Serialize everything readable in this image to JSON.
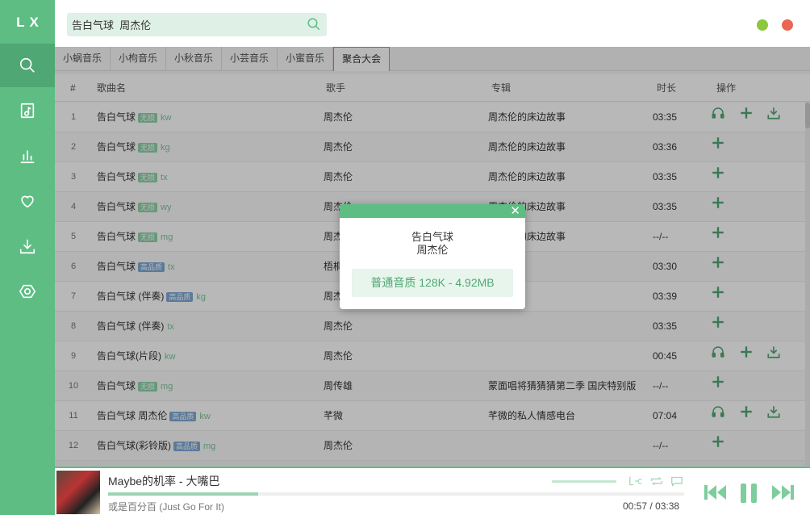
{
  "app": {
    "logo": "LX"
  },
  "search": {
    "value": "告白气球  周杰伦"
  },
  "sources": {
    "tabs": [
      {
        "label": "小蜗音乐"
      },
      {
        "label": "小枸音乐"
      },
      {
        "label": "小秋音乐"
      },
      {
        "label": "小芸音乐"
      },
      {
        "label": "小蜜音乐"
      },
      {
        "label": "聚合大会"
      }
    ],
    "active_index": 5
  },
  "table": {
    "headers": {
      "index": "#",
      "name": "歌曲名",
      "singer": "歌手",
      "album": "专辑",
      "duration": "时长",
      "ops": "操作"
    },
    "rows": [
      {
        "idx": "1",
        "name": "告白气球",
        "badge": "无损",
        "badge_type": "lossless",
        "src": "kw",
        "singer": "周杰伦",
        "album": "周杰伦的床边故事",
        "duration": "03:35",
        "ops": [
          "listen",
          "add",
          "download"
        ]
      },
      {
        "idx": "2",
        "name": "告白气球",
        "badge": "无损",
        "badge_type": "lossless",
        "src": "kg",
        "singer": "周杰伦",
        "album": "周杰伦的床边故事",
        "duration": "03:36",
        "ops": [
          "add"
        ]
      },
      {
        "idx": "3",
        "name": "告白气球",
        "badge": "无损",
        "badge_type": "lossless",
        "src": "tx",
        "singer": "周杰伦",
        "album": "周杰伦的床边故事",
        "duration": "03:35",
        "ops": [
          "add"
        ]
      },
      {
        "idx": "4",
        "name": "告白气球",
        "badge": "无损",
        "badge_type": "lossless",
        "src": "wy",
        "singer": "周杰伦",
        "album": "周杰伦的床边故事",
        "duration": "03:35",
        "ops": [
          "add"
        ]
      },
      {
        "idx": "5",
        "name": "告白气球",
        "badge": "无损",
        "badge_type": "lossless",
        "src": "mg",
        "singer": "周杰伦",
        "album": "周杰伦的床边故事",
        "duration": "--/--",
        "ops": [
          "add"
        ]
      },
      {
        "idx": "6",
        "name": "告白气球",
        "badge": "高品质",
        "badge_type": "hq",
        "src": "tx",
        "singer": "梧桐",
        "album": "",
        "duration": "03:30",
        "ops": [
          "add"
        ]
      },
      {
        "idx": "7",
        "name": "告白气球 (伴奏)",
        "badge": "高品质",
        "badge_type": "hq",
        "src": "kg",
        "singer": "周杰伦",
        "album": "",
        "duration": "03:39",
        "ops": [
          "add"
        ]
      },
      {
        "idx": "8",
        "name": "告白气球 (伴奏)",
        "badge": "",
        "badge_type": "",
        "src": "tx",
        "singer": "周杰伦",
        "album": "",
        "duration": "03:35",
        "ops": [
          "add"
        ]
      },
      {
        "idx": "9",
        "name": "告白气球(片段)",
        "badge": "",
        "badge_type": "",
        "src": "kw",
        "singer": "周杰伦",
        "album": "",
        "duration": "00:45",
        "ops": [
          "listen",
          "add",
          "download"
        ]
      },
      {
        "idx": "10",
        "name": "告白气球",
        "badge": "无损",
        "badge_type": "lossless",
        "src": "mg",
        "singer": "周传雄",
        "album": "蒙面唱将猜猜猜第二季 国庆特别版",
        "duration": "--/--",
        "ops": [
          "add"
        ]
      },
      {
        "idx": "11",
        "name": "告白气球 周杰伦",
        "badge": "高品质",
        "badge_type": "hq",
        "src": "kw",
        "singer": "芊微",
        "album": "芊微的私人情感电台",
        "duration": "07:04",
        "ops": [
          "listen",
          "add",
          "download"
        ]
      },
      {
        "idx": "12",
        "name": "告白气球(彩铃版)",
        "badge": "高品质",
        "badge_type": "hq",
        "src": "mg",
        "singer": "周杰伦",
        "album": "",
        "duration": "--/--",
        "ops": [
          "add"
        ]
      }
    ]
  },
  "modal": {
    "title": "告白气球",
    "singer": "周杰伦",
    "quality_option": "普通音质 128K - 4.92MB"
  },
  "player": {
    "title": "Maybe的机率 - 大嘴巴",
    "album": "或是百分百 (Just Go For It)",
    "time_current": "00:57",
    "time_sep": "/",
    "time_total": "03:38",
    "progress_fraction": 0.26
  },
  "colors": {
    "accent": "#5ebd83",
    "accent_dark": "#4fa874",
    "minimize": "#8dc63f",
    "close": "#ea6652"
  }
}
